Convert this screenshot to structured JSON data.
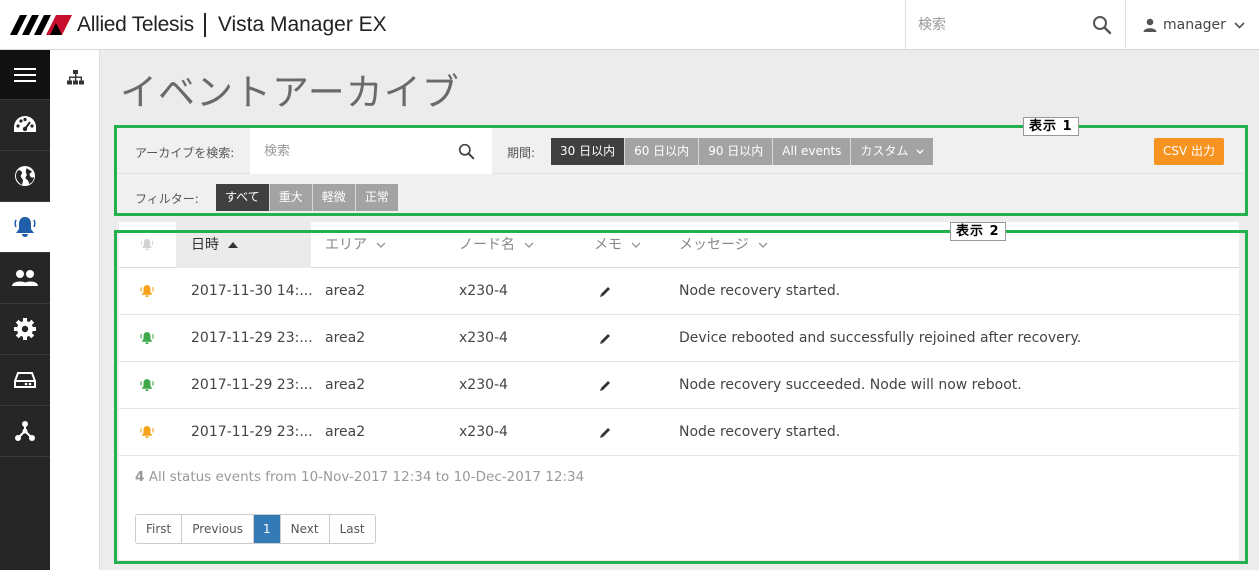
{
  "header": {
    "brand": "Allied Telesis",
    "product": "Vista Manager EX",
    "search_placeholder": "検索",
    "user": "manager"
  },
  "sidebar": {
    "items": [
      {
        "name": "menu-icon"
      },
      {
        "name": "dashboard-icon"
      },
      {
        "name": "globe-icon"
      },
      {
        "name": "bell-icon",
        "active": true
      },
      {
        "name": "users-icon"
      },
      {
        "name": "gear-icon"
      },
      {
        "name": "drive-icon"
      },
      {
        "name": "network-icon"
      }
    ]
  },
  "page": {
    "title": "イベントアーカイブ"
  },
  "filters": {
    "search_label": "アーカイブを検索:",
    "search_placeholder": "検索",
    "period_label": "期間:",
    "period_options": [
      "30 日以内",
      "60 日以内",
      "90 日以内",
      "All events",
      "カスタム"
    ],
    "period_selected": "30 日以内",
    "filter_label": "フィルター:",
    "filter_options": [
      "すべて",
      "重大",
      "軽微",
      "正常"
    ],
    "filter_selected": "すべて",
    "csv_label": "CSV 出力"
  },
  "annotations": {
    "box1": "表示 1",
    "box2": "表示 2"
  },
  "table": {
    "columns": {
      "datetime": "日時",
      "area": "エリア",
      "node": "ノード名",
      "memo": "メモ",
      "message": "メッセージ"
    },
    "rows": [
      {
        "severity": "minor",
        "datetime": "2017-11-30 14:...",
        "area": "area2",
        "node": "x230-4",
        "message": "Node recovery started."
      },
      {
        "severity": "normal",
        "datetime": "2017-11-29 23:...",
        "area": "area2",
        "node": "x230-4",
        "message": "Device rebooted and successfully rejoined after recovery."
      },
      {
        "severity": "normal",
        "datetime": "2017-11-29 23:...",
        "area": "area2",
        "node": "x230-4",
        "message": "Node recovery succeeded. Node will now reboot."
      },
      {
        "severity": "minor",
        "datetime": "2017-11-29 23:...",
        "area": "area2",
        "node": "x230-4",
        "message": "Node recovery started."
      }
    ]
  },
  "summary": {
    "count": "4",
    "text": "All status events from 10-Nov-2017 12:34 to 10-Dec-2017 12:34"
  },
  "pagination": {
    "first": "First",
    "previous": "Previous",
    "current": "1",
    "next": "Next",
    "last": "Last"
  },
  "colors": {
    "minor": "#f7a21b",
    "normal": "#3fa84a",
    "accent": "#f79321",
    "outline": "#22b14c",
    "page_active": "#337ab7"
  }
}
